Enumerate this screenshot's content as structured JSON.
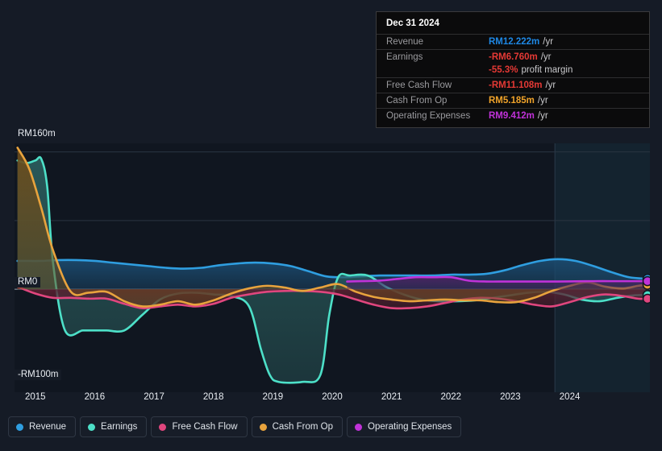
{
  "tooltip": {
    "date": "Dec 31 2024",
    "rows": [
      {
        "label": "Revenue",
        "value": "RM12.222m",
        "unit": "/yr",
        "color": "#1e88e5"
      },
      {
        "label": "Earnings",
        "value": "-RM6.760m",
        "unit": "/yr",
        "color": "#e53935"
      },
      {
        "label": "",
        "value": "-55.3%",
        "unit": "profit margin",
        "color": "#e53935",
        "no_rule": true
      },
      {
        "label": "Free Cash Flow",
        "value": "-RM11.108m",
        "unit": "/yr",
        "color": "#e53935"
      },
      {
        "label": "Cash From Op",
        "value": "RM5.185m",
        "unit": "/yr",
        "color": "#f0a32a"
      },
      {
        "label": "Operating Expenses",
        "value": "RM9.412m",
        "unit": "/yr",
        "color": "#c032d8"
      }
    ]
  },
  "legend": {
    "items": [
      {
        "label": "Revenue",
        "color": "#2f9ee0"
      },
      {
        "label": "Earnings",
        "color": "#4de0c8"
      },
      {
        "label": "Free Cash Flow",
        "color": "#e0467e"
      },
      {
        "label": "Cash From Op",
        "color": "#e8a33d"
      },
      {
        "label": "Operating Expenses",
        "color": "#c032d8"
      }
    ]
  },
  "chart_data": {
    "type": "area",
    "title": "",
    "xlabel": "",
    "ylabel": "",
    "currency": "RM",
    "units": "m",
    "ylim": [
      -120,
      170
    ],
    "yticks": [
      160,
      0,
      -100
    ],
    "ytick_labels": [
      "RM160m",
      "RM0",
      "-RM100m"
    ],
    "grid": true,
    "gridline_values": [
      160,
      80,
      0
    ],
    "legend_position": "bottom",
    "x_tick_labels": [
      "2015",
      "2016",
      "2017",
      "2018",
      "2019",
      "2020",
      "2021",
      "2022",
      "2023",
      "2024"
    ],
    "x_tick_values": [
      2015,
      2016,
      2017,
      2018,
      2019,
      2020,
      2021,
      2022,
      2023,
      2024
    ],
    "xlim": [
      2014.65,
      2025.35
    ],
    "forecast_region": {
      "from": 2023.75,
      "to": 2025.35,
      "label": ""
    },
    "series": [
      {
        "name": "Revenue",
        "color": "#2f9ee0",
        "fill": "#1b4a6e",
        "x": [
          2014.7,
          2014.9,
          2015.1,
          2015.4,
          2015.7,
          2016.0,
          2016.3,
          2016.6,
          2016.9,
          2017.2,
          2017.5,
          2017.8,
          2018.1,
          2018.4,
          2018.7,
          2019.0,
          2019.3,
          2019.6,
          2019.9,
          2020.2,
          2020.5,
          2020.8,
          2021.1,
          2021.4,
          2021.7,
          2022.0,
          2022.3,
          2022.6,
          2022.9,
          2023.2,
          2023.5,
          2023.8,
          2024.1,
          2024.4,
          2024.7,
          2025.0,
          2025.3
        ],
        "y": [
          33,
          33,
          33,
          34,
          34,
          33,
          31,
          29,
          27,
          25,
          24,
          25,
          28,
          30,
          31,
          30,
          27,
          21,
          15,
          14,
          15,
          16,
          16,
          16,
          16,
          17,
          17,
          18,
          22,
          28,
          33,
          35,
          33,
          27,
          20,
          14,
          12.222
        ]
      },
      {
        "name": "Earnings",
        "color": "#4de0c8",
        "fill": "#2a5c5c",
        "x": [
          2014.7,
          2014.85,
          2015.0,
          2015.1,
          2015.2,
          2015.3,
          2015.5,
          2015.8,
          2016.0,
          2016.2,
          2016.5,
          2016.8,
          2017.1,
          2017.4,
          2017.7,
          2018.0,
          2018.3,
          2018.6,
          2018.8,
          2018.95,
          2019.1,
          2019.5,
          2019.8,
          2019.95,
          2020.1,
          2020.3,
          2020.6,
          2020.9,
          2021.2,
          2021.5,
          2021.8,
          2022.1,
          2022.4,
          2022.7,
          2023.0,
          2023.3,
          2023.6,
          2023.9,
          2024.2,
          2024.5,
          2024.8,
          2025.1,
          2025.3
        ],
        "y": [
          150,
          147,
          150,
          152,
          120,
          30,
          -48,
          -48,
          -48,
          -48,
          -48,
          -30,
          -12,
          -5,
          -4,
          -6,
          -8,
          -20,
          -70,
          -100,
          -108,
          -108,
          -100,
          -30,
          14,
          16,
          16,
          3,
          -6,
          -12,
          -14,
          -14,
          -13,
          -10,
          -7,
          -4,
          -3,
          -6,
          -12,
          -14,
          -10,
          -7,
          -6.76
        ]
      },
      {
        "name": "Free Cash Flow",
        "color": "#e0467e",
        "fill": "#5a2030",
        "x": [
          2014.7,
          2015.0,
          2015.3,
          2015.6,
          2015.9,
          2016.2,
          2016.5,
          2016.8,
          2017.1,
          2017.4,
          2017.7,
          2018.0,
          2018.3,
          2018.6,
          2018.9,
          2019.2,
          2019.5,
          2019.8,
          2020.1,
          2020.4,
          2020.7,
          2021.0,
          2021.3,
          2021.6,
          2021.9,
          2022.2,
          2022.5,
          2022.8,
          2023.1,
          2023.4,
          2023.7,
          2024.0,
          2024.3,
          2024.6,
          2024.9,
          2025.15,
          2025.3
        ],
        "y": [
          3,
          -5,
          -10,
          -10,
          -11,
          -11,
          -17,
          -22,
          -20,
          -18,
          -20,
          -17,
          -10,
          -6,
          -3,
          -2,
          -2,
          -3,
          -6,
          -12,
          -18,
          -22,
          -22,
          -20,
          -16,
          -12,
          -10,
          -11,
          -14,
          -18,
          -20,
          -15,
          -9,
          -6,
          -8,
          -11,
          -11.108
        ]
      },
      {
        "name": "Cash From Op",
        "color": "#e8a33d",
        "fill": "#6b4c1c",
        "x": [
          2014.7,
          2014.9,
          2015.1,
          2015.3,
          2015.6,
          2015.9,
          2016.2,
          2016.5,
          2016.8,
          2017.1,
          2017.4,
          2017.7,
          2018.0,
          2018.3,
          2018.6,
          2018.9,
          2019.2,
          2019.5,
          2019.8,
          2020.1,
          2020.4,
          2020.7,
          2021.0,
          2021.3,
          2021.6,
          2021.9,
          2022.2,
          2022.5,
          2022.8,
          2023.1,
          2023.4,
          2023.7,
          2024.0,
          2024.3,
          2024.6,
          2024.9,
          2025.15,
          2025.3
        ],
        "y": [
          165,
          140,
          95,
          45,
          -3,
          -4,
          -3,
          -14,
          -20,
          -18,
          -14,
          -18,
          -13,
          -5,
          1,
          4,
          2,
          -2,
          2,
          6,
          -3,
          -9,
          -12,
          -14,
          -13,
          -12,
          -13,
          -13,
          -15,
          -15,
          -10,
          -2,
          4,
          8,
          3,
          1,
          4,
          5.185
        ]
      },
      {
        "name": "Operating Expenses",
        "color": "#c032d8",
        "fill": "#4a2360",
        "x": [
          2020.25,
          2020.5,
          2020.8,
          2021.1,
          2021.4,
          2021.7,
          2022.0,
          2022.3,
          2022.6,
          2022.9,
          2023.2,
          2023.5,
          2023.8,
          2024.1,
          2024.4,
          2024.7,
          2025.0,
          2025.3
        ],
        "y": [
          9,
          9.5,
          10,
          12,
          14,
          14,
          14,
          10,
          9,
          9,
          9,
          9,
          9,
          9.2,
          9.4,
          9.4,
          9.4,
          9.412
        ]
      }
    ],
    "endpoint_markers": [
      {
        "name": "Revenue",
        "value": 12.222,
        "color": "#2f9ee0"
      },
      {
        "name": "Earnings",
        "value": -6.76,
        "color": "#4de0c8"
      },
      {
        "name": "Free Cash Flow",
        "value": -11.108,
        "color": "#e0467e"
      },
      {
        "name": "Cash From Op",
        "value": 5.185,
        "color": "#e8a33d"
      },
      {
        "name": "Operating Expenses",
        "value": 9.412,
        "color": "#c032d8"
      }
    ]
  }
}
